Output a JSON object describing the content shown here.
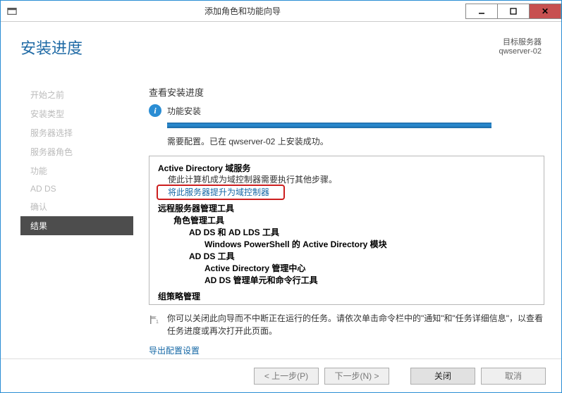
{
  "titlebar": {
    "title": "添加角色和功能向导"
  },
  "header": {
    "title": "安装进度",
    "dest_label": "目标服务器",
    "dest_value": "qwserver-02"
  },
  "sidebar": {
    "steps": [
      {
        "label": "开始之前"
      },
      {
        "label": "安装类型"
      },
      {
        "label": "服务器选择"
      },
      {
        "label": "服务器角色"
      },
      {
        "label": "功能"
      },
      {
        "label": "AD DS"
      },
      {
        "label": "确认"
      },
      {
        "label": "结果",
        "active": true
      }
    ]
  },
  "main": {
    "section_title": "查看安装进度",
    "feature_install": "功能安装",
    "status_line": "需要配置。已在 qwserver-02 上安装成功。",
    "detail": {
      "title": "Active Directory 域服务",
      "line1": "使此计算机成为域控制器需要执行其他步骤。",
      "promote_link": "将此服务器提升为域控制器",
      "tree": {
        "n1": "远程服务器管理工具",
        "n2": "角色管理工具",
        "n3": "AD DS 和 AD LDS 工具",
        "n4": "Windows PowerShell 的 Active Directory 模块",
        "n5": "AD DS 工具",
        "n6": "Active Directory 管理中心",
        "n7": "AD DS 管理单元和命令行工具",
        "n8": "组策略管理"
      }
    },
    "hint": "你可以关闭此向导而不中断正在运行的任务。请依次单击命令栏中的\"通知\"和\"任务详细信息\"，以查看任务进度或再次打开此页面。",
    "export_link": "导出配置设置"
  },
  "footer": {
    "prev": "< 上一步(P)",
    "next": "下一步(N) >",
    "close": "关闭",
    "cancel": "取消"
  }
}
